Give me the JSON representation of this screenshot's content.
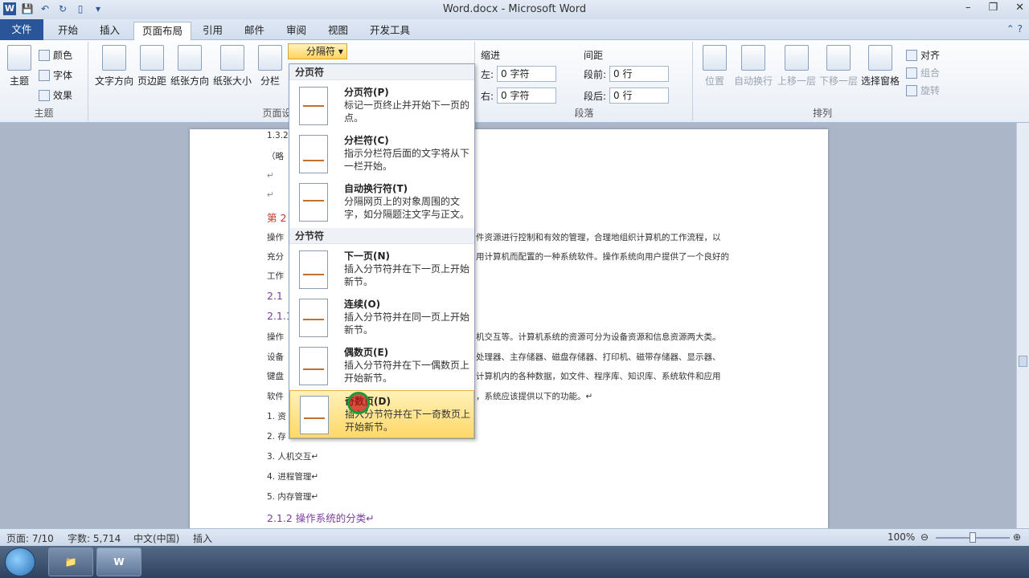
{
  "window": {
    "title": "Word.docx - Microsoft Word",
    "min": "–",
    "restore": "❐",
    "close": "✕"
  },
  "qat": {
    "logo": "W",
    "save": "💾",
    "undo": "↶",
    "redo": "↻",
    "new": "▯",
    "more": "▾"
  },
  "tabs": [
    "文件",
    "开始",
    "插入",
    "页面布局",
    "引用",
    "邮件",
    "审阅",
    "视图",
    "开发工具"
  ],
  "tab_help": "⌃ ?",
  "ribbon": {
    "theme": {
      "themes": "主题",
      "colors": "颜色",
      "fonts": "字体",
      "effects": "效果",
      "label": "主题"
    },
    "page_setup": {
      "text_dir": "文字方向",
      "margins": "页边距",
      "orientation": "纸张方向",
      "size": "纸张大小",
      "columns": "分栏",
      "breaks": "分隔符",
      "label": "页面设置"
    },
    "paragraph": {
      "indent": "缩进",
      "left": "左:",
      "left_val": "0 字符",
      "right": "右:",
      "right_val": "0 字符",
      "spacing": "间距",
      "before": "段前:",
      "before_val": "0 行",
      "after": "段后:",
      "after_val": "0 行",
      "label": "段落"
    },
    "arrange": {
      "position": "位置",
      "wrap": "自动换行",
      "forward": "上移一层",
      "backward": "下移一层",
      "pane": "选择窗格",
      "align": "对齐",
      "group": "组合",
      "rotate": "旋转",
      "label": "排列"
    }
  },
  "dropdown": {
    "section1": "分页符",
    "section2": "分节符",
    "items": [
      {
        "title": "分页符(P)",
        "desc": "标记一页终止并开始下一页的点。"
      },
      {
        "title": "分栏符(C)",
        "desc": "指示分栏符后面的文字将从下一栏开始。"
      },
      {
        "title": "自动换行符(T)",
        "desc": "分隔网页上的对象周围的文字，如分隔题注文字与正文。"
      },
      {
        "title": "下一页(N)",
        "desc": "插入分节符并在下一页上开始新节。"
      },
      {
        "title": "连续(O)",
        "desc": "插入分节符并在同一页上开始新节。"
      },
      {
        "title": "偶数页(E)",
        "desc": "插入分节符并在下一偶数页上开始新节。"
      },
      {
        "title": "奇数页(D)",
        "desc": "插入分节符并在下一奇数页上开始新节。"
      }
    ]
  },
  "doc": {
    "lines": [
      "1.3.2",
      "（略",
      "↵",
      "↵",
      "第 2",
      "操作",
      "充分",
      "工作",
      "2.1",
      "2.1.1",
      "操作",
      "设备",
      "键盘",
      "软件",
      "1. 资",
      "2. 存",
      "3. 人机交互↵",
      "4. 进程管理↵",
      "5. 内存管理↵",
      "2.1.2 操作系统的分类↵"
    ],
    "frag1": "件资源进行控制和有效的管理，合理地组织计算机的工作流程，以",
    "frag2": "用计算机而配置的一种系统软件。操作系统向用户提供了一个良好的",
    "frag3": "机交互等。计算机系统的资源可分为设备资源和信息资源两大类。",
    "frag4": "处理器、主存储器、磁盘存储器、打印机、磁带存储器、显示器、",
    "frag5": "计算机内的各种数据，如文件、程序库、知识库、系统软件和应用",
    "frag6": "，系统应该提供以下的功能。↵"
  },
  "status": {
    "page": "页面: 7/10",
    "words": "字数: 5,714",
    "lang": "中文(中国)",
    "mode": "插入",
    "zoom": "100%",
    "zoom_minus": "⊖",
    "zoom_plus": "⊕"
  },
  "taskbar": {
    "explorer": "📁",
    "word": "W"
  }
}
